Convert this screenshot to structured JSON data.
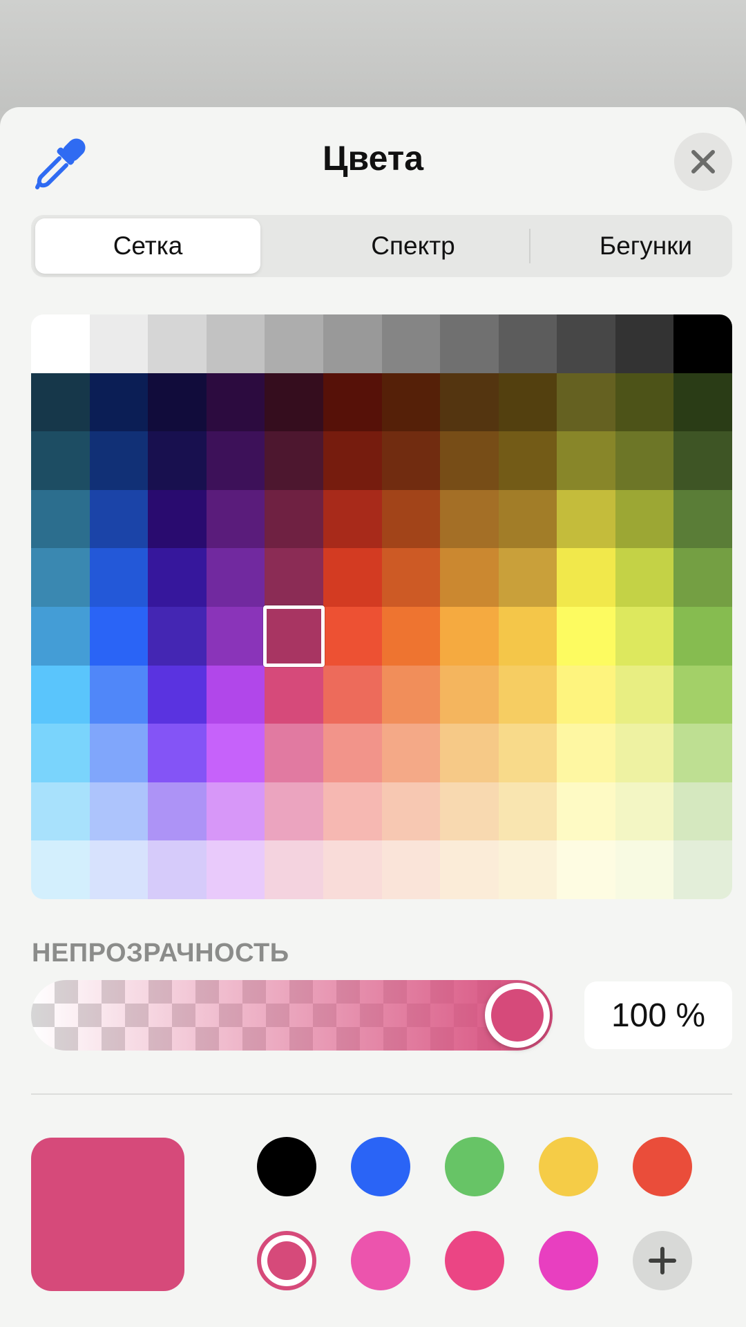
{
  "header": {
    "title": "Цвета",
    "eyedropper_icon": "eyedropper-icon",
    "close_icon": "close-icon"
  },
  "tabs": [
    {
      "label": "Сетка",
      "active": true
    },
    {
      "label": "Спектр",
      "active": false
    },
    {
      "label": "Бегунки",
      "active": false
    }
  ],
  "grid": {
    "columns": 12,
    "rows": 10,
    "selected": {
      "row": 5,
      "col": 4
    },
    "colors": [
      [
        "#ffffff",
        "#ebebeb",
        "#d6d6d6",
        "#c2c2c2",
        "#adadad",
        "#999999",
        "#858585",
        "#707070",
        "#5c5c5c",
        "#474747",
        "#333333",
        "#000000"
      ],
      [
        "#16374a",
        "#0b1e55",
        "#110c3b",
        "#2c0b3f",
        "#350d1e",
        "#561108",
        "#552008",
        "#543510",
        "#53400f",
        "#656121",
        "#4d5318",
        "#2a3c16"
      ],
      [
        "#1d4d63",
        "#113076",
        "#18104f",
        "#3d1159",
        "#4d172f",
        "#761c0e",
        "#712c10",
        "#774d17",
        "#735b17",
        "#888629",
        "#6d7627",
        "#3e5525"
      ],
      [
        "#2c6e8e",
        "#1b44a8",
        "#290b6f",
        "#5a1c7b",
        "#6f2142",
        "#a82a1a",
        "#a24419",
        "#a46f26",
        "#a27d28",
        "#c4bc3b",
        "#9ca734",
        "#5a7d37"
      ],
      [
        "#3a88b1",
        "#2358d8",
        "#36179c",
        "#71299f",
        "#8b2c55",
        "#d33b22",
        "#cd5a25",
        "#cb8830",
        "#c9a03a",
        "#f1e84b",
        "#c4d246",
        "#749f43"
      ],
      [
        "#449dd6",
        "#2a64f6",
        "#4426b3",
        "#8a34b9",
        "#a83562",
        "#ed5133",
        "#ee7430",
        "#f5aa40",
        "#f4c649",
        "#fdfb60",
        "#dde85e",
        "#86bc50"
      ],
      [
        "#5ac5fc",
        "#5087f9",
        "#5a33e0",
        "#b147ea",
        "#d64a7a",
        "#ed6b5b",
        "#f18e5a",
        "#f4b55e",
        "#f6cd62",
        "#fef47e",
        "#e8ee82",
        "#a3d068"
      ],
      [
        "#7ad4fc",
        "#80a6fb",
        "#8454f6",
        "#c662fa",
        "#e17aa1",
        "#f2948a",
        "#f4a987",
        "#f6c987",
        "#f8da8a",
        "#fef7a2",
        "#eef2a2",
        "#bedf92"
      ],
      [
        "#a8e1fc",
        "#adc4fc",
        "#ad93f6",
        "#d797f8",
        "#eba4bf",
        "#f6b8b2",
        "#f7c8b2",
        "#f8d9b0",
        "#f9e5b0",
        "#fefac4",
        "#f3f6c4",
        "#d5e8bf"
      ],
      [
        "#d3effd",
        "#d7e2fd",
        "#d6cbfa",
        "#e9cafb",
        "#f4d3df",
        "#f9dcd9",
        "#faE4d9",
        "#fbecd8",
        "#fbf2d8",
        "#fefcE2",
        "#f8fae2",
        "#e3eed9"
      ]
    ]
  },
  "opacity": {
    "label": "НЕПРОЗРАЧНОСТЬ",
    "value_text": "100 %",
    "value": 1.0,
    "color": "#d64a7a"
  },
  "current_color": "#d64a7a",
  "favorites": [
    {
      "color": "#000000",
      "selected": false
    },
    {
      "color": "#2a64f6",
      "selected": false
    },
    {
      "color": "#67c466",
      "selected": false
    },
    {
      "color": "#f5cc47",
      "selected": false
    },
    {
      "color": "#ea4d3a",
      "selected": false
    },
    {
      "color": "#d64a7a",
      "selected": true
    },
    {
      "color": "#ec54ad",
      "selected": false
    },
    {
      "color": "#eb4584",
      "selected": false
    },
    {
      "color": "#e83fc0",
      "selected": false
    }
  ],
  "add_icon": "plus-icon"
}
